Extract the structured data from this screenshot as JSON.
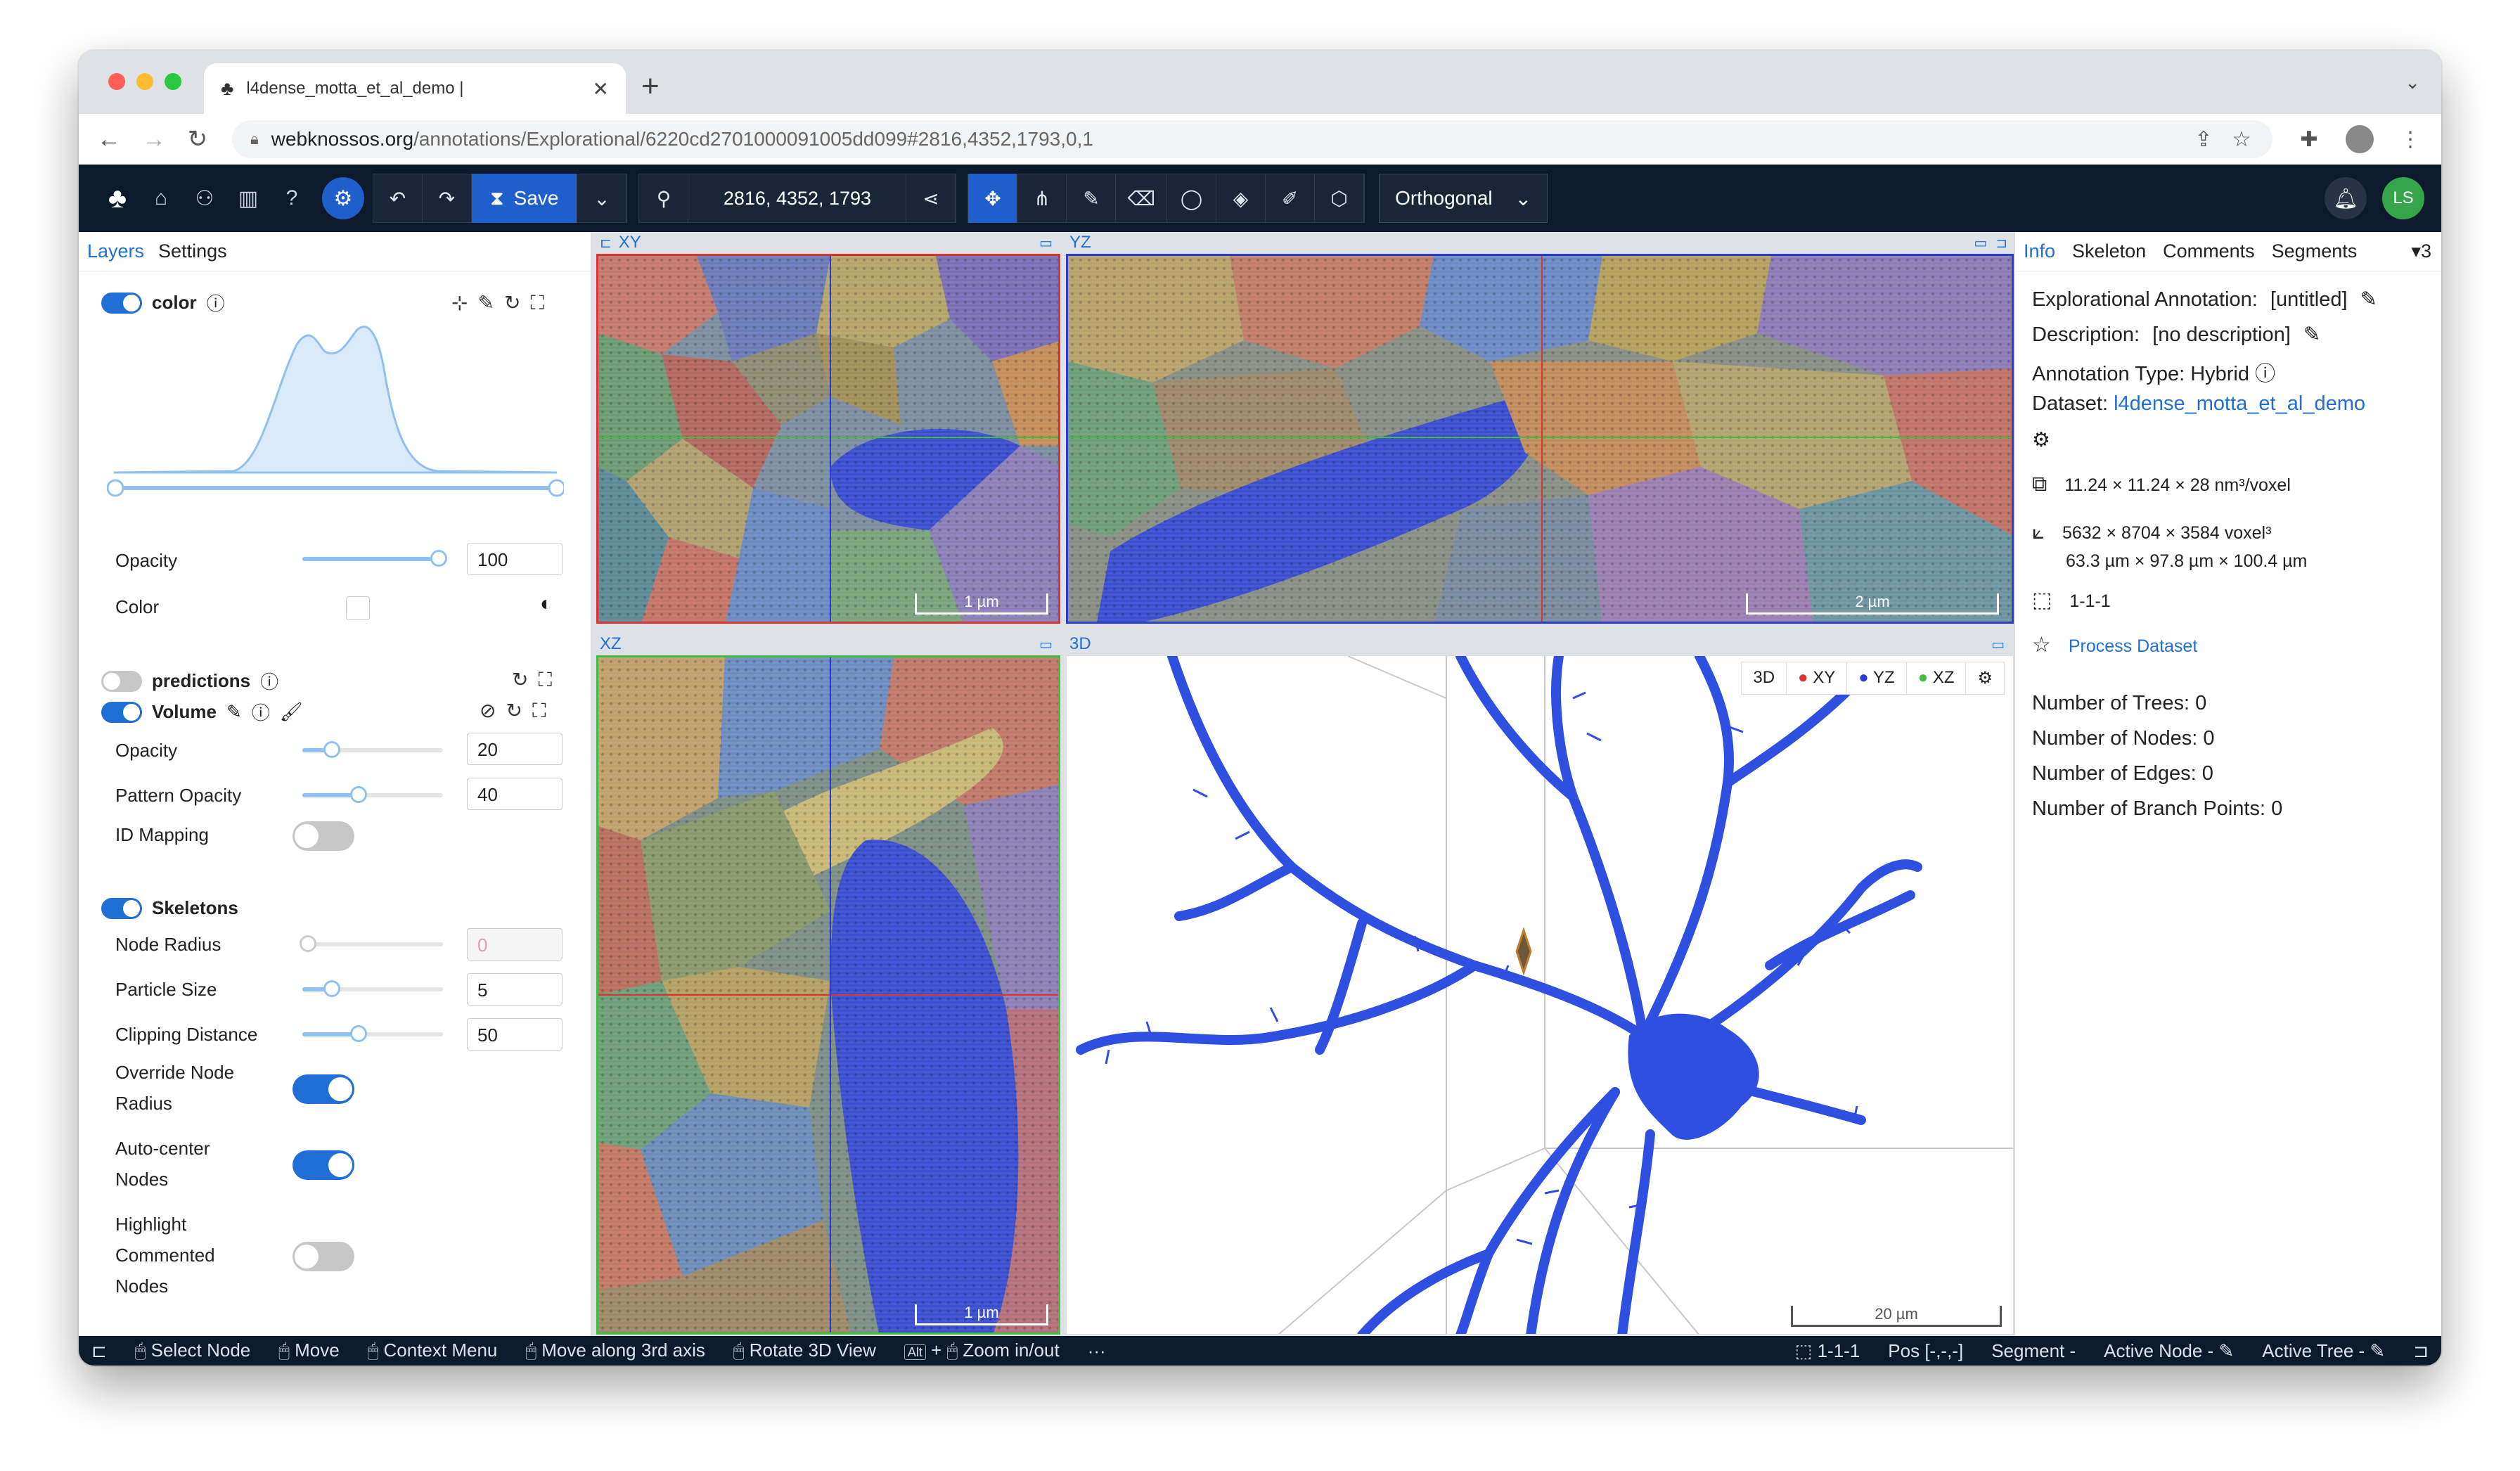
{
  "browser": {
    "tab_title": "l4dense_motta_et_al_demo | ",
    "url_host": "webknossos.org",
    "url_path": "/annotations/Explorational/6220cd2701000091005dd099#2816,4352,1793,0,1"
  },
  "toolbar": {
    "save_label": "Save",
    "position": "2816, 4352, 1793",
    "view_mode": "Orthogonal",
    "user_initials": "LS"
  },
  "left_panel": {
    "tabs": [
      "Layers",
      "Settings"
    ],
    "color_layer": {
      "name": "color",
      "opacity_label": "Opacity",
      "opacity_value": "100",
      "color_label": "Color"
    },
    "predictions": {
      "name": "predictions"
    },
    "volume": {
      "name": "Volume",
      "opacity_label": "Opacity",
      "opacity_value": "20",
      "pattern_label": "Pattern Opacity",
      "pattern_value": "40",
      "id_mapping_label": "ID Mapping"
    },
    "skeletons": {
      "name": "Skeletons",
      "node_radius_label": "Node Radius",
      "node_radius_value": "0",
      "particle_size_label": "Particle Size",
      "particle_size_value": "5",
      "clipping_label": "Clipping Distance",
      "clipping_value": "50",
      "override_l1": "Override Node",
      "override_l2": "Radius",
      "autocenter_l1": "Auto-center",
      "autocenter_l2": "Nodes",
      "highlight_l1": "Highlight",
      "highlight_l2": "Commented",
      "highlight_l3": "Nodes"
    }
  },
  "viewports": {
    "xy": {
      "label": "XY",
      "scale": "1 µm"
    },
    "yz": {
      "label": "YZ",
      "scale": "2 µm"
    },
    "xz": {
      "label": "XZ",
      "scale": "1 µm"
    },
    "td": {
      "label": "3D",
      "scale": "20 µm"
    },
    "td_buttons": [
      "3D",
      "XY",
      "YZ",
      "XZ"
    ]
  },
  "right_panel": {
    "tabs": [
      "Info",
      "Skeleton",
      "Comments",
      "Segments"
    ],
    "tab_count": "3",
    "annotation_label": "Explorational Annotation:",
    "annotation_name": "[untitled]",
    "description_label": "Description:",
    "description_value": "[no description]",
    "type_label": "Annotation Type: Hybrid",
    "dataset_label": "Dataset:",
    "dataset_name": "l4dense_motta_et_al_demo",
    "voxel_size": "11.24 × 11.24 × 28 nm³/voxel",
    "extent_voxels": "5632 × 8704 × 3584 voxel³",
    "extent_um": "63.3 µm × 97.8 µm × 100.4 µm",
    "mag": "1-1-1",
    "process_link": "Process Dataset",
    "trees": "Number of Trees: 0",
    "nodes": "Number of Nodes: 0",
    "edges": "Number of Edges: 0",
    "branch": "Number of Branch Points: 0"
  },
  "statusbar": {
    "select_node": "Select Node",
    "move": "Move",
    "context_menu": "Context Menu",
    "move_3rd": "Move along 3rd axis",
    "rotate": "Rotate 3D View",
    "alt": "Alt",
    "zoom": "Zoom in/out",
    "more": "···",
    "mag": "1-1-1",
    "pos": "Pos [-,-,-]",
    "segment": "Segment -",
    "active_node": "Active Node -",
    "active_tree": "Active Tree -"
  }
}
